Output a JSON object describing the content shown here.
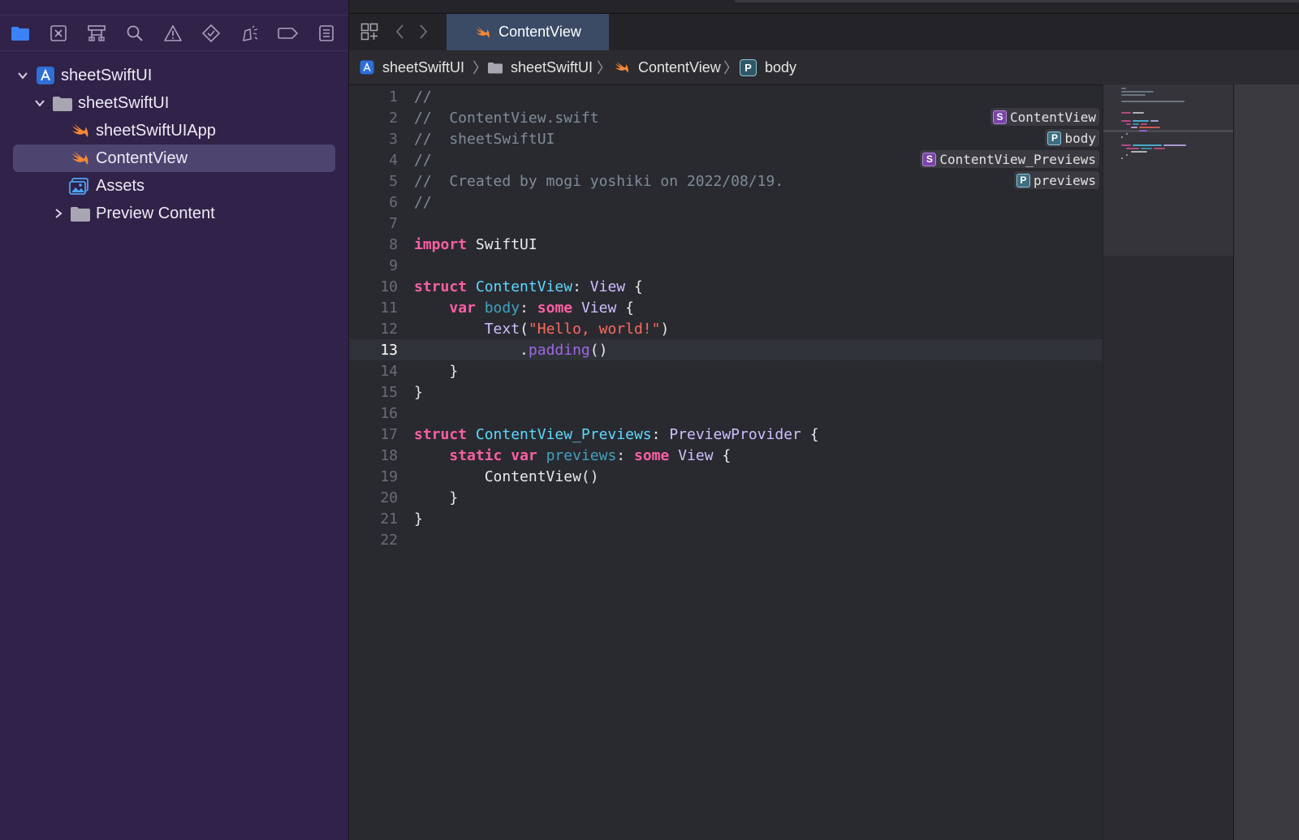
{
  "navigator": {
    "tree": [
      {
        "label": "sheetSwiftUI",
        "icon": "project-icon",
        "expanded": true
      },
      {
        "label": "sheetSwiftUI",
        "icon": "folder-icon",
        "expanded": true
      },
      {
        "label": "sheetSwiftUIApp",
        "icon": "swift-file-icon"
      },
      {
        "label": "ContentView",
        "icon": "swift-file-icon",
        "selected": true
      },
      {
        "label": "Assets",
        "icon": "asset-catalog-icon"
      },
      {
        "label": "Preview Content",
        "icon": "folder-icon",
        "expanded": false
      }
    ]
  },
  "tab": {
    "label": "ContentView"
  },
  "breadcrumb": [
    "sheetSwiftUI",
    "sheetSwiftUI",
    "ContentView",
    "body"
  ],
  "code": {
    "current_line": 13,
    "line_numbers": [
      "1",
      "2",
      "3",
      "4",
      "5",
      "6",
      "7",
      "8",
      "9",
      "10",
      "11",
      "12",
      "13",
      "14",
      "15",
      "16",
      "17",
      "18",
      "19",
      "20",
      "21",
      "22"
    ],
    "header": {
      "l1": "//",
      "l2": "//  ContentView.swift",
      "l3": "//  sheetSwiftUI",
      "l4": "//",
      "l5": "//  Created by mogi yoshiki on 2022/08/19.",
      "l6": "//"
    },
    "kw_import": "import",
    "swiftui": "SwiftUI",
    "kw_struct": "struct",
    "kw_var": "var",
    "kw_some": "some",
    "kw_static": "static",
    "contentview": "ContentView",
    "view": "View",
    "body": "body",
    "text": "Text",
    "hello": "\"Hello, world!\"",
    "padding": "padding",
    "previews_type": "ContentView_Previews",
    "preview_provider": "PreviewProvider",
    "previews": "previews",
    "contentview_call": "ContentView"
  },
  "symbols": [
    {
      "kind": "S",
      "name": "ContentView"
    },
    {
      "kind": "P",
      "name": "body"
    },
    {
      "kind": "S",
      "name": "ContentView_Previews"
    },
    {
      "kind": "P",
      "name": "previews"
    }
  ],
  "colors": {
    "sidebar_bg": "#302248",
    "editor_bg": "#292a30",
    "keyword": "#fc5fa3",
    "string": "#fc6a5d",
    "comment": "#7f8c98",
    "type_decl": "#5dd8ff",
    "type_ref": "#d0bfff"
  },
  "icons": [
    "folder-icon",
    "source-control-icon",
    "hierarchy-icon",
    "search-icon",
    "warning-icon",
    "test-icon",
    "debug-icon",
    "breakpoint-icon",
    "report-icon",
    "grid-icon",
    "back-icon",
    "forward-icon"
  ]
}
